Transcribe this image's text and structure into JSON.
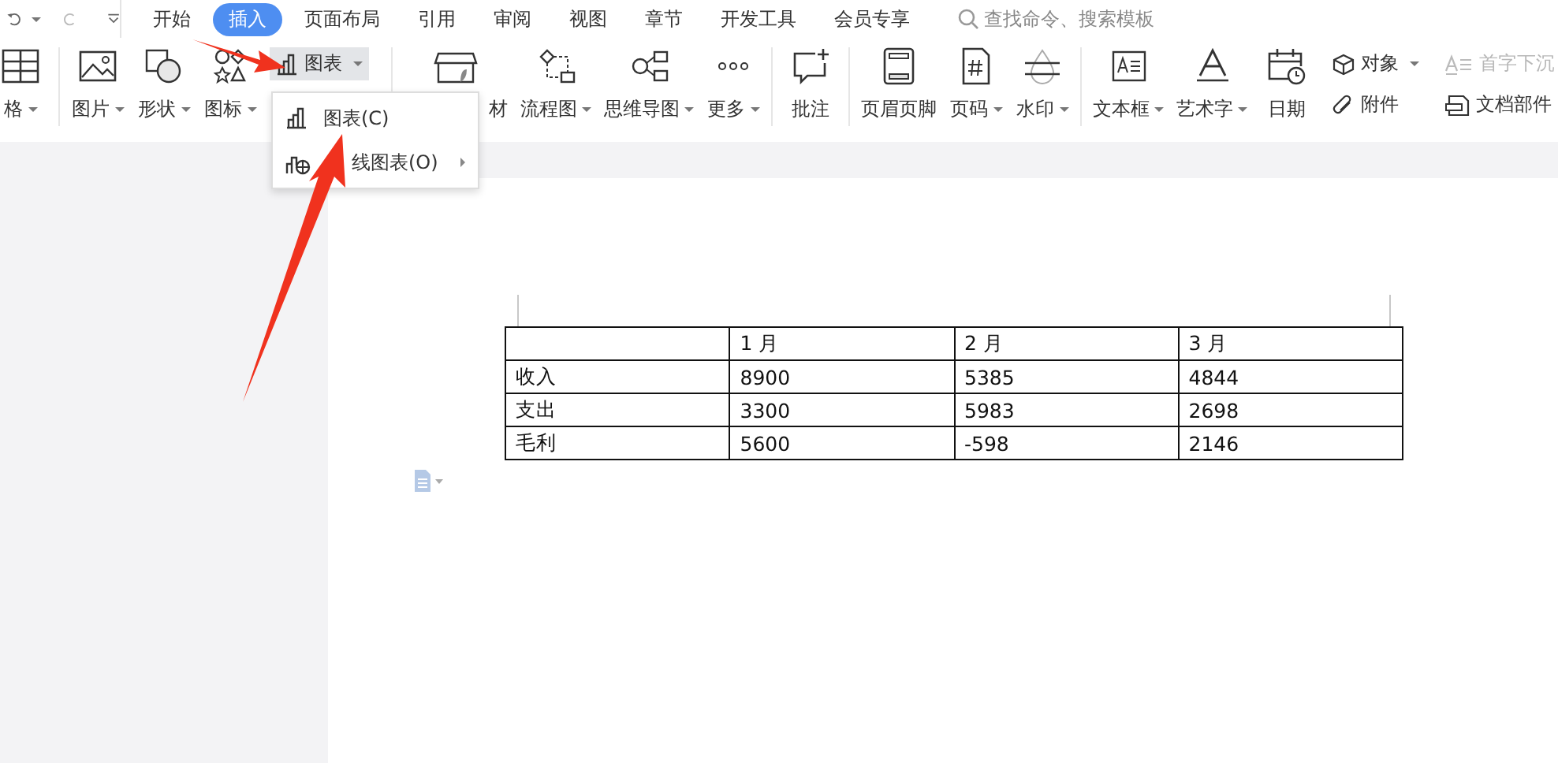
{
  "tabs": [
    {
      "label": "开始",
      "selected": false
    },
    {
      "label": "插入",
      "selected": true
    },
    {
      "label": "页面布局",
      "selected": false
    },
    {
      "label": "引用",
      "selected": false
    },
    {
      "label": "审阅",
      "selected": false
    },
    {
      "label": "视图",
      "selected": false
    },
    {
      "label": "章节",
      "selected": false
    },
    {
      "label": "开发工具",
      "selected": false
    },
    {
      "label": "会员专享",
      "selected": false
    }
  ],
  "search": {
    "placeholder": "查找命令、搜索模板"
  },
  "ribbon_groups": [
    [
      {
        "kind": "large",
        "label": "格",
        "dropdown": true
      }
    ],
    [
      {
        "kind": "large",
        "label": "图片",
        "dropdown": true
      },
      {
        "kind": "large",
        "label": "形状",
        "dropdown": true
      },
      {
        "kind": "large",
        "label": "图标",
        "dropdown": true
      },
      {
        "kind": "chart",
        "label": "图表",
        "dropdown": true,
        "open": true
      }
    ],
    [
      {
        "kind": "large",
        "label": "材",
        "dropdown": false
      },
      {
        "kind": "large",
        "label": "流程图",
        "dropdown": true
      },
      {
        "kind": "large",
        "label": "思维导图",
        "dropdown": true
      },
      {
        "kind": "large",
        "label": "更多",
        "dropdown": true
      }
    ],
    [
      {
        "kind": "large",
        "label": "批注",
        "dropdown": false
      }
    ],
    [
      {
        "kind": "large",
        "label": "页眉页脚",
        "dropdown": false
      },
      {
        "kind": "large",
        "label": "页码",
        "dropdown": true
      },
      {
        "kind": "large",
        "label": "水印",
        "dropdown": true
      }
    ],
    [
      {
        "kind": "large",
        "label": "文本框",
        "dropdown": true
      },
      {
        "kind": "large",
        "label": "艺术字",
        "dropdown": true
      },
      {
        "kind": "large",
        "label": "日期",
        "dropdown": false
      },
      {
        "kind": "pair",
        "items": [
          {
            "label": "对象",
            "dropdown": true,
            "disabled": false
          },
          {
            "label": "附件",
            "dropdown": false,
            "disabled": false
          }
        ]
      },
      {
        "kind": "pair",
        "items": [
          {
            "label": "首字下沉",
            "dropdown": false,
            "disabled": true
          },
          {
            "label": "文档部件",
            "dropdown": false,
            "disabled": false
          }
        ]
      }
    ]
  ],
  "menu": [
    {
      "label": "图表(C)",
      "submenu": false
    },
    {
      "label": "线图表(O)",
      "submenu": true
    }
  ],
  "table": {
    "columns": [
      "",
      "1 月",
      "2 月",
      "3 月"
    ],
    "rows": [
      [
        "收入",
        "8900",
        "5385",
        "4844"
      ],
      [
        "支出",
        "3300",
        "5983",
        "2698"
      ],
      [
        "毛利",
        "5600",
        "-598",
        "2146"
      ]
    ]
  }
}
